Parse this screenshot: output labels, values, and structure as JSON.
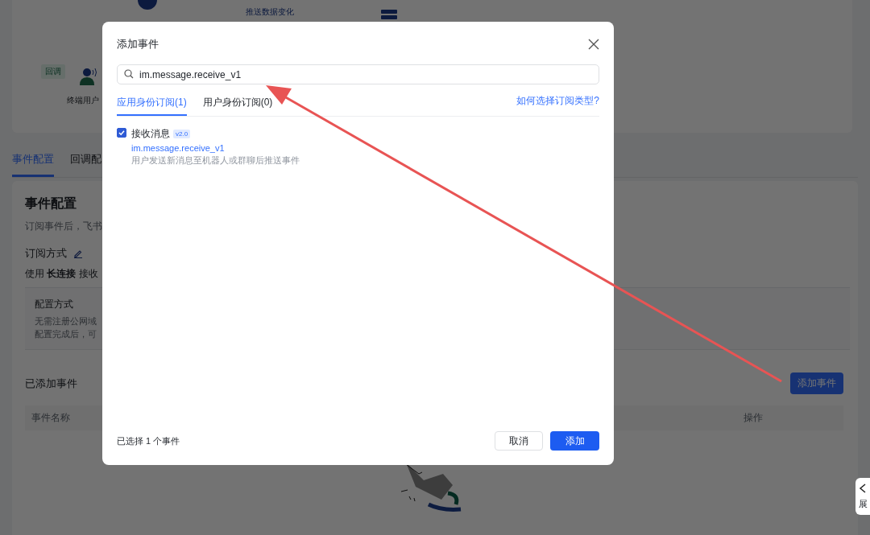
{
  "background": {
    "flow": {
      "step_label": "推送数据变化",
      "tag": "回调",
      "user_label": "终端用户"
    },
    "tabs": [
      {
        "label": "事件配置",
        "selected": true
      },
      {
        "label": "回调配",
        "selected": false
      }
    ],
    "section": {
      "title": "事件配置",
      "description": "订阅事件后，飞书",
      "method_label": "订阅方式",
      "method_text": "使用 **长连接** 接收",
      "config_box": {
        "title": "配置方式",
        "lines": [
          "无需注册公网域",
          "配置完成后，可"
        ]
      },
      "added_title": "已添加事件",
      "add_button": "添加事件",
      "table": {
        "columns": [
          "事件名称",
          "操作"
        ]
      }
    },
    "side_tab": {
      "label": "展"
    }
  },
  "dialog": {
    "title": "添加事件",
    "search": {
      "value": "im.message.receive_v1"
    },
    "tabs": [
      {
        "label": "应用身份订阅(1)",
        "selected": true
      },
      {
        "label": "用户身份订阅(0)",
        "selected": false
      }
    ],
    "help_link": "如何选择订阅类型?",
    "events": [
      {
        "name": "接收消息",
        "version": "v2.0",
        "key": "im.message.receive_v1",
        "description": "用户发送新消息至机器人或群聊后推送事件",
        "checked": true
      }
    ],
    "selection_summary": "已选择 1 个事件",
    "buttons": [
      {
        "label": "取消",
        "kind": "secondary"
      },
      {
        "label": "添加",
        "kind": "primary"
      }
    ]
  }
}
